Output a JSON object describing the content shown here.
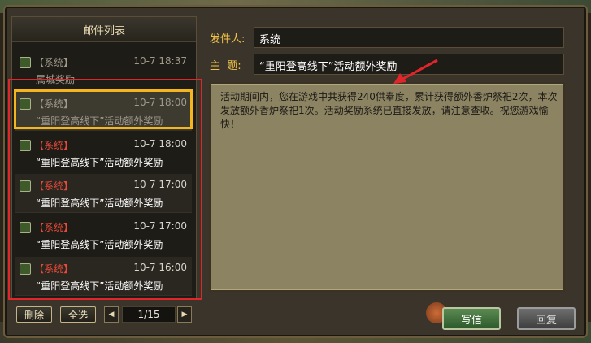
{
  "list": {
    "title": "邮件列表",
    "items": [
      {
        "sender": "【系统】",
        "date": "10-7 18:37",
        "subject": "属城奖励",
        "style": "read"
      },
      {
        "sender": "【系统】",
        "date": "10-7 18:00",
        "subject": "“重阳登高线下”活动额外奖励",
        "style": "selected"
      },
      {
        "sender": "【系统】",
        "date": "10-7 18:00",
        "subject": "“重阳登高线下”活动额外奖励",
        "style": "unread"
      },
      {
        "sender": "【系统】",
        "date": "10-7 17:00",
        "subject": "“重阳登高线下”活动额外奖励",
        "style": "unread"
      },
      {
        "sender": "【系统】",
        "date": "10-7 17:00",
        "subject": "“重阳登高线下”活动额外奖励",
        "style": "unread"
      },
      {
        "sender": "【系统】",
        "date": "10-7 16:00",
        "subject": "“重阳登高线下”活动额外奖励",
        "style": "unread"
      }
    ]
  },
  "detail": {
    "sender_label": "发件人:",
    "sender_value": "系统",
    "subject_label": "主  题:",
    "subject_value": "“重阳登高线下”活动额外奖励",
    "body": "活动期间内，您在游戏中共获得240供奉度，累计获得额外香炉祭祀2次，本次发放额外香炉祭祀1次。活动奖励系统已直接发放，请注意查收。祝您游戏愉快！"
  },
  "controls": {
    "delete_label": "删除",
    "select_all_label": "全选",
    "prev_icon": "triangle-left-icon",
    "next_icon": "triangle-right-icon",
    "page": "1/15",
    "write_label": "写信",
    "reply_label": "回复"
  },
  "colors": {
    "highlight_red": "#e0262a",
    "highlight_gold": "#f4b51e",
    "label_gold": "#f0c24a",
    "sender_red": "#e84a3a"
  }
}
